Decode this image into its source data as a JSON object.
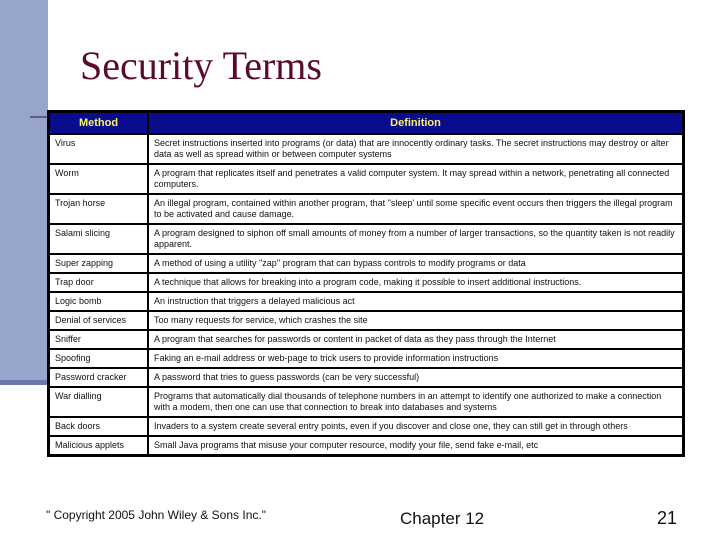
{
  "slide": {
    "title": "Security Terms",
    "table": {
      "headers": [
        "Method",
        "Definition"
      ],
      "rows": [
        {
          "method": "Virus",
          "definition": "Secret instructions inserted into programs (or data) that are innocently ordinary tasks. The secret instructions may destroy or alter data as well as spread within or between computer systems"
        },
        {
          "method": "Worm",
          "definition": "A program that replicates itself and penetrates a valid computer system. It may spread within a network, penetrating all connected computers."
        },
        {
          "method": "Trojan horse",
          "definition": "An illegal program, contained within another program, that \"sleep' until some specific event occurs then triggers the illegal program to be activated and cause damage."
        },
        {
          "method": "Salami slicing",
          "definition": "A program designed to siphon off small amounts of money from a number of larger transactions, so  the quantity taken is not readily apparent."
        },
        {
          "method": "Super zapping",
          "definition": "A method of using a utility \"zap'' program that can bypass controls to modify programs or data"
        },
        {
          "method": "Trap door",
          "definition": "A technique that allows for breaking into a program code, making it possible to insert additional instructions."
        },
        {
          "method": "Logic bomb",
          "definition": "An instruction that  triggers a delayed malicious act"
        },
        {
          "method": "Denial of services",
          "definition": "Too many requests for service, which crashes the site"
        },
        {
          "method": "Sniffer",
          "definition": "A program that searches for passwords or content in packet of data as they pass through the Internet"
        },
        {
          "method": "Spoofing",
          "definition": "Faking an e-mail address or web-page to trick users to provide information instructions"
        },
        {
          "method": "Password cracker",
          "definition": "A password that tries to guess passwords (can be very successful)"
        },
        {
          "method": "War dialling",
          "definition": "Programs that automatically  dial thousands of telephone numbers in an attempt to identify one authorized to make a connection with a modem, then one can use that connection to break into databases and systems"
        },
        {
          "method": "Back doors",
          "definition": "Invaders to a system  create several entry points, even if you discover and close  one, they can still get in through others"
        },
        {
          "method": "Malicious applets",
          "definition": "Small Java programs that misuse your computer resource, modify your file, send fake e-mail, etc"
        }
      ]
    },
    "footer": {
      "copyright": "\" Copyright 2005 John Wiley & Sons Inc.\"",
      "chapter": "Chapter 12",
      "page_number": "21"
    },
    "colors": {
      "title": "#5a0a2e",
      "header_bg": "#0b0b8e",
      "header_text": "#f5f56a",
      "sidebar": "#97a4cc"
    }
  }
}
